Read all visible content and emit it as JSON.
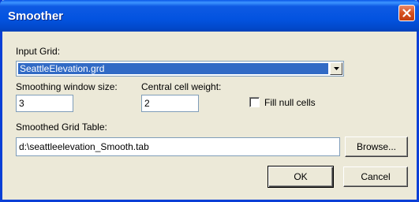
{
  "window": {
    "title": "Smoother",
    "close_icon": "close-x-icon"
  },
  "input_grid": {
    "label": "Input Grid:",
    "selected_value": "SeattleElevation.grd",
    "dropdown_icon": "chevron-down-icon"
  },
  "smoothing_window": {
    "label": "Smoothing window size:",
    "value": "3"
  },
  "central_weight": {
    "label": "Central cell weight:",
    "value": "2"
  },
  "fill_null": {
    "label": "Fill null cells",
    "checked": false
  },
  "output_table": {
    "label": "Smoothed Grid Table:",
    "value": "d:\\seattleelevation_Smooth.tab",
    "browse_label": "Browse..."
  },
  "buttons": {
    "ok_label": "OK",
    "cancel_label": "Cancel"
  },
  "colors": {
    "titlebar": "#0353e0",
    "dialog_bg": "#ece9d8",
    "selection": "#316ac5",
    "close_button": "#d6501f"
  }
}
